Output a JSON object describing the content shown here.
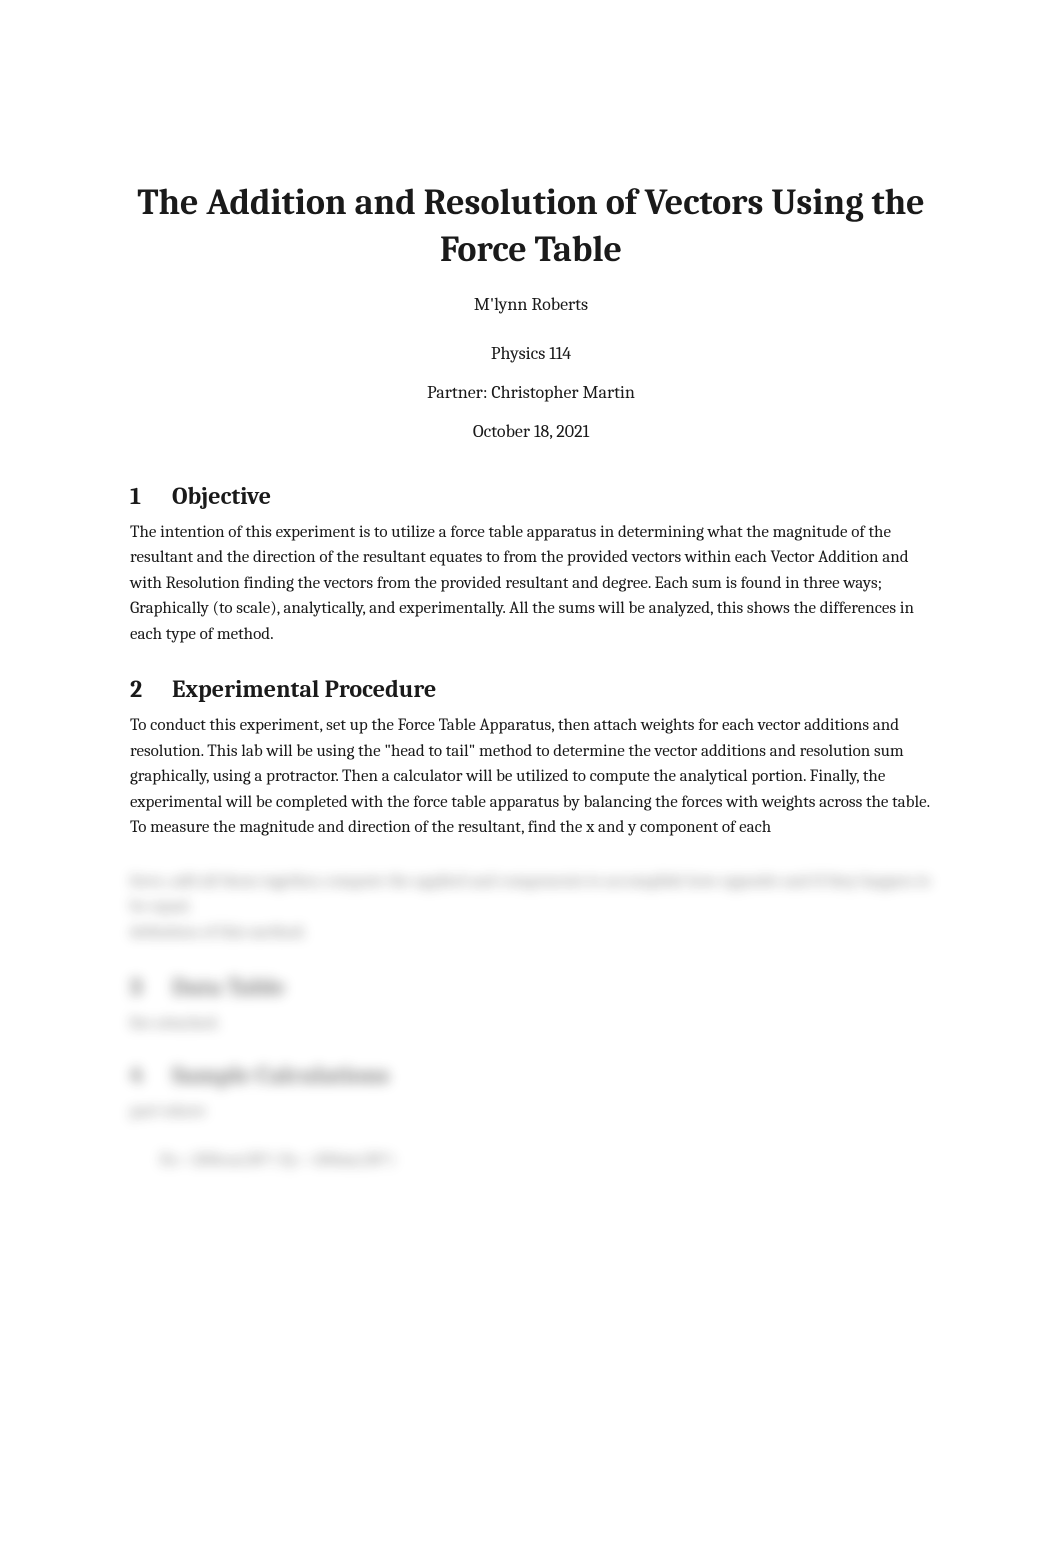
{
  "title": "The Addition and Resolution of Vectors Using the Force Table",
  "author": "M'lynn Roberts",
  "course": "Physics 114",
  "partner": "Partner: Christopher Martin",
  "date": "October 18, 2021",
  "sections": {
    "s1": {
      "num": "1",
      "title": "Objective",
      "body": "The intention of this experiment is to utilize a force table apparatus in determining what the magnitude of the resultant and the direction of the resultant equates to from the provided vectors within each Vector Addition and with Resolution finding the vectors from the provided resultant and degree. Each sum is found in three ways; Graphically (to scale), analytically, and experimentally.  All the sums will be analyzed, this shows the differences in each type of method."
    },
    "s2": {
      "num": "2",
      "title": "Experimental Procedure",
      "body": "To conduct this experiment, set up the Force Table Apparatus, then attach weights for each vector additions and resolution. This lab will be using the \"head to tail\" method to determine the vector additions and resolution sum graphically, using a protractor. Then a calculator will be utilized to compute the analytical portion. Finally, the experimental will be completed with the force table apparatus by balancing the forces with weights across the table. To measure the magnitude and direction of the resultant, find the x and y component of each"
    },
    "blurred": {
      "line1": "force, add all them together, compute the applied  and  components to accomplish how opposite and if they happen to be equal.",
      "line2": "definition of this method.",
      "s3": {
        "num": "3",
        "title": "Data Table",
        "body": "See attached."
      },
      "s4": {
        "num": "4",
        "title": "Sample Calculations",
        "body": "part where",
        "formula": "Fx = 200cos(30°)        Fy = 100sin(30°)"
      }
    }
  }
}
